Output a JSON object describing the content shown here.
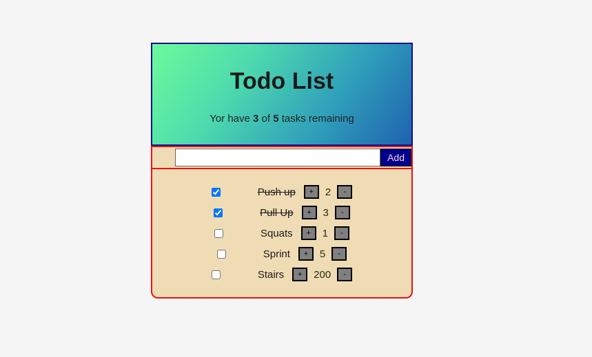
{
  "app": {
    "title": "Todo List",
    "summary": {
      "prefix": "Yor have ",
      "remaining": "3",
      "middle": " of ",
      "total": "5",
      "suffix": " tasks remaining"
    }
  },
  "add_form": {
    "input_value": "",
    "input_placeholder": "",
    "add_label": "Add"
  },
  "controls": {
    "increment_label": "+",
    "decrement_label": "-"
  },
  "items": [
    {
      "label": "Push up",
      "count": "2",
      "done": true
    },
    {
      "label": "Pull Up",
      "count": "3",
      "done": true
    },
    {
      "label": "Squats",
      "count": "1",
      "done": false
    },
    {
      "label": "Sprint",
      "count": "5",
      "done": false
    },
    {
      "label": "Stairs",
      "count": "200",
      "done": false
    }
  ],
  "colors": {
    "page_background": "#f5f5f5",
    "card_background": "#f0dcb4",
    "card_border": "#ee1111",
    "header_border": "#101090",
    "header_gradient_start": "#6cfa9a",
    "header_gradient_end": "#1f62ae",
    "add_button_background": "#00008f",
    "add_button_text": "#f7cfcf",
    "step_button_background": "#808080",
    "checkbox_checked": "#2b7fff"
  }
}
